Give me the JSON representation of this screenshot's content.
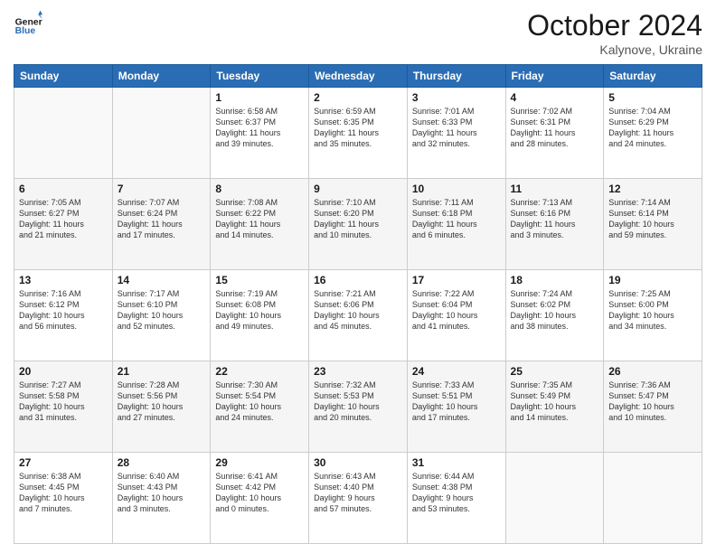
{
  "header": {
    "title": "October 2024",
    "subtitle": "Kalynove, Ukraine"
  },
  "columns": [
    "Sunday",
    "Monday",
    "Tuesday",
    "Wednesday",
    "Thursday",
    "Friday",
    "Saturday"
  ],
  "weeks": [
    [
      {
        "day": "",
        "info": ""
      },
      {
        "day": "",
        "info": ""
      },
      {
        "day": "1",
        "info": "Sunrise: 6:58 AM\nSunset: 6:37 PM\nDaylight: 11 hours\nand 39 minutes."
      },
      {
        "day": "2",
        "info": "Sunrise: 6:59 AM\nSunset: 6:35 PM\nDaylight: 11 hours\nand 35 minutes."
      },
      {
        "day": "3",
        "info": "Sunrise: 7:01 AM\nSunset: 6:33 PM\nDaylight: 11 hours\nand 32 minutes."
      },
      {
        "day": "4",
        "info": "Sunrise: 7:02 AM\nSunset: 6:31 PM\nDaylight: 11 hours\nand 28 minutes."
      },
      {
        "day": "5",
        "info": "Sunrise: 7:04 AM\nSunset: 6:29 PM\nDaylight: 11 hours\nand 24 minutes."
      }
    ],
    [
      {
        "day": "6",
        "info": "Sunrise: 7:05 AM\nSunset: 6:27 PM\nDaylight: 11 hours\nand 21 minutes."
      },
      {
        "day": "7",
        "info": "Sunrise: 7:07 AM\nSunset: 6:24 PM\nDaylight: 11 hours\nand 17 minutes."
      },
      {
        "day": "8",
        "info": "Sunrise: 7:08 AM\nSunset: 6:22 PM\nDaylight: 11 hours\nand 14 minutes."
      },
      {
        "day": "9",
        "info": "Sunrise: 7:10 AM\nSunset: 6:20 PM\nDaylight: 11 hours\nand 10 minutes."
      },
      {
        "day": "10",
        "info": "Sunrise: 7:11 AM\nSunset: 6:18 PM\nDaylight: 11 hours\nand 6 minutes."
      },
      {
        "day": "11",
        "info": "Sunrise: 7:13 AM\nSunset: 6:16 PM\nDaylight: 11 hours\nand 3 minutes."
      },
      {
        "day": "12",
        "info": "Sunrise: 7:14 AM\nSunset: 6:14 PM\nDaylight: 10 hours\nand 59 minutes."
      }
    ],
    [
      {
        "day": "13",
        "info": "Sunrise: 7:16 AM\nSunset: 6:12 PM\nDaylight: 10 hours\nand 56 minutes."
      },
      {
        "day": "14",
        "info": "Sunrise: 7:17 AM\nSunset: 6:10 PM\nDaylight: 10 hours\nand 52 minutes."
      },
      {
        "day": "15",
        "info": "Sunrise: 7:19 AM\nSunset: 6:08 PM\nDaylight: 10 hours\nand 49 minutes."
      },
      {
        "day": "16",
        "info": "Sunrise: 7:21 AM\nSunset: 6:06 PM\nDaylight: 10 hours\nand 45 minutes."
      },
      {
        "day": "17",
        "info": "Sunrise: 7:22 AM\nSunset: 6:04 PM\nDaylight: 10 hours\nand 41 minutes."
      },
      {
        "day": "18",
        "info": "Sunrise: 7:24 AM\nSunset: 6:02 PM\nDaylight: 10 hours\nand 38 minutes."
      },
      {
        "day": "19",
        "info": "Sunrise: 7:25 AM\nSunset: 6:00 PM\nDaylight: 10 hours\nand 34 minutes."
      }
    ],
    [
      {
        "day": "20",
        "info": "Sunrise: 7:27 AM\nSunset: 5:58 PM\nDaylight: 10 hours\nand 31 minutes."
      },
      {
        "day": "21",
        "info": "Sunrise: 7:28 AM\nSunset: 5:56 PM\nDaylight: 10 hours\nand 27 minutes."
      },
      {
        "day": "22",
        "info": "Sunrise: 7:30 AM\nSunset: 5:54 PM\nDaylight: 10 hours\nand 24 minutes."
      },
      {
        "day": "23",
        "info": "Sunrise: 7:32 AM\nSunset: 5:53 PM\nDaylight: 10 hours\nand 20 minutes."
      },
      {
        "day": "24",
        "info": "Sunrise: 7:33 AM\nSunset: 5:51 PM\nDaylight: 10 hours\nand 17 minutes."
      },
      {
        "day": "25",
        "info": "Sunrise: 7:35 AM\nSunset: 5:49 PM\nDaylight: 10 hours\nand 14 minutes."
      },
      {
        "day": "26",
        "info": "Sunrise: 7:36 AM\nSunset: 5:47 PM\nDaylight: 10 hours\nand 10 minutes."
      }
    ],
    [
      {
        "day": "27",
        "info": "Sunrise: 6:38 AM\nSunset: 4:45 PM\nDaylight: 10 hours\nand 7 minutes."
      },
      {
        "day": "28",
        "info": "Sunrise: 6:40 AM\nSunset: 4:43 PM\nDaylight: 10 hours\nand 3 minutes."
      },
      {
        "day": "29",
        "info": "Sunrise: 6:41 AM\nSunset: 4:42 PM\nDaylight: 10 hours\nand 0 minutes."
      },
      {
        "day": "30",
        "info": "Sunrise: 6:43 AM\nSunset: 4:40 PM\nDaylight: 9 hours\nand 57 minutes."
      },
      {
        "day": "31",
        "info": "Sunrise: 6:44 AM\nSunset: 4:38 PM\nDaylight: 9 hours\nand 53 minutes."
      },
      {
        "day": "",
        "info": ""
      },
      {
        "day": "",
        "info": ""
      }
    ]
  ]
}
